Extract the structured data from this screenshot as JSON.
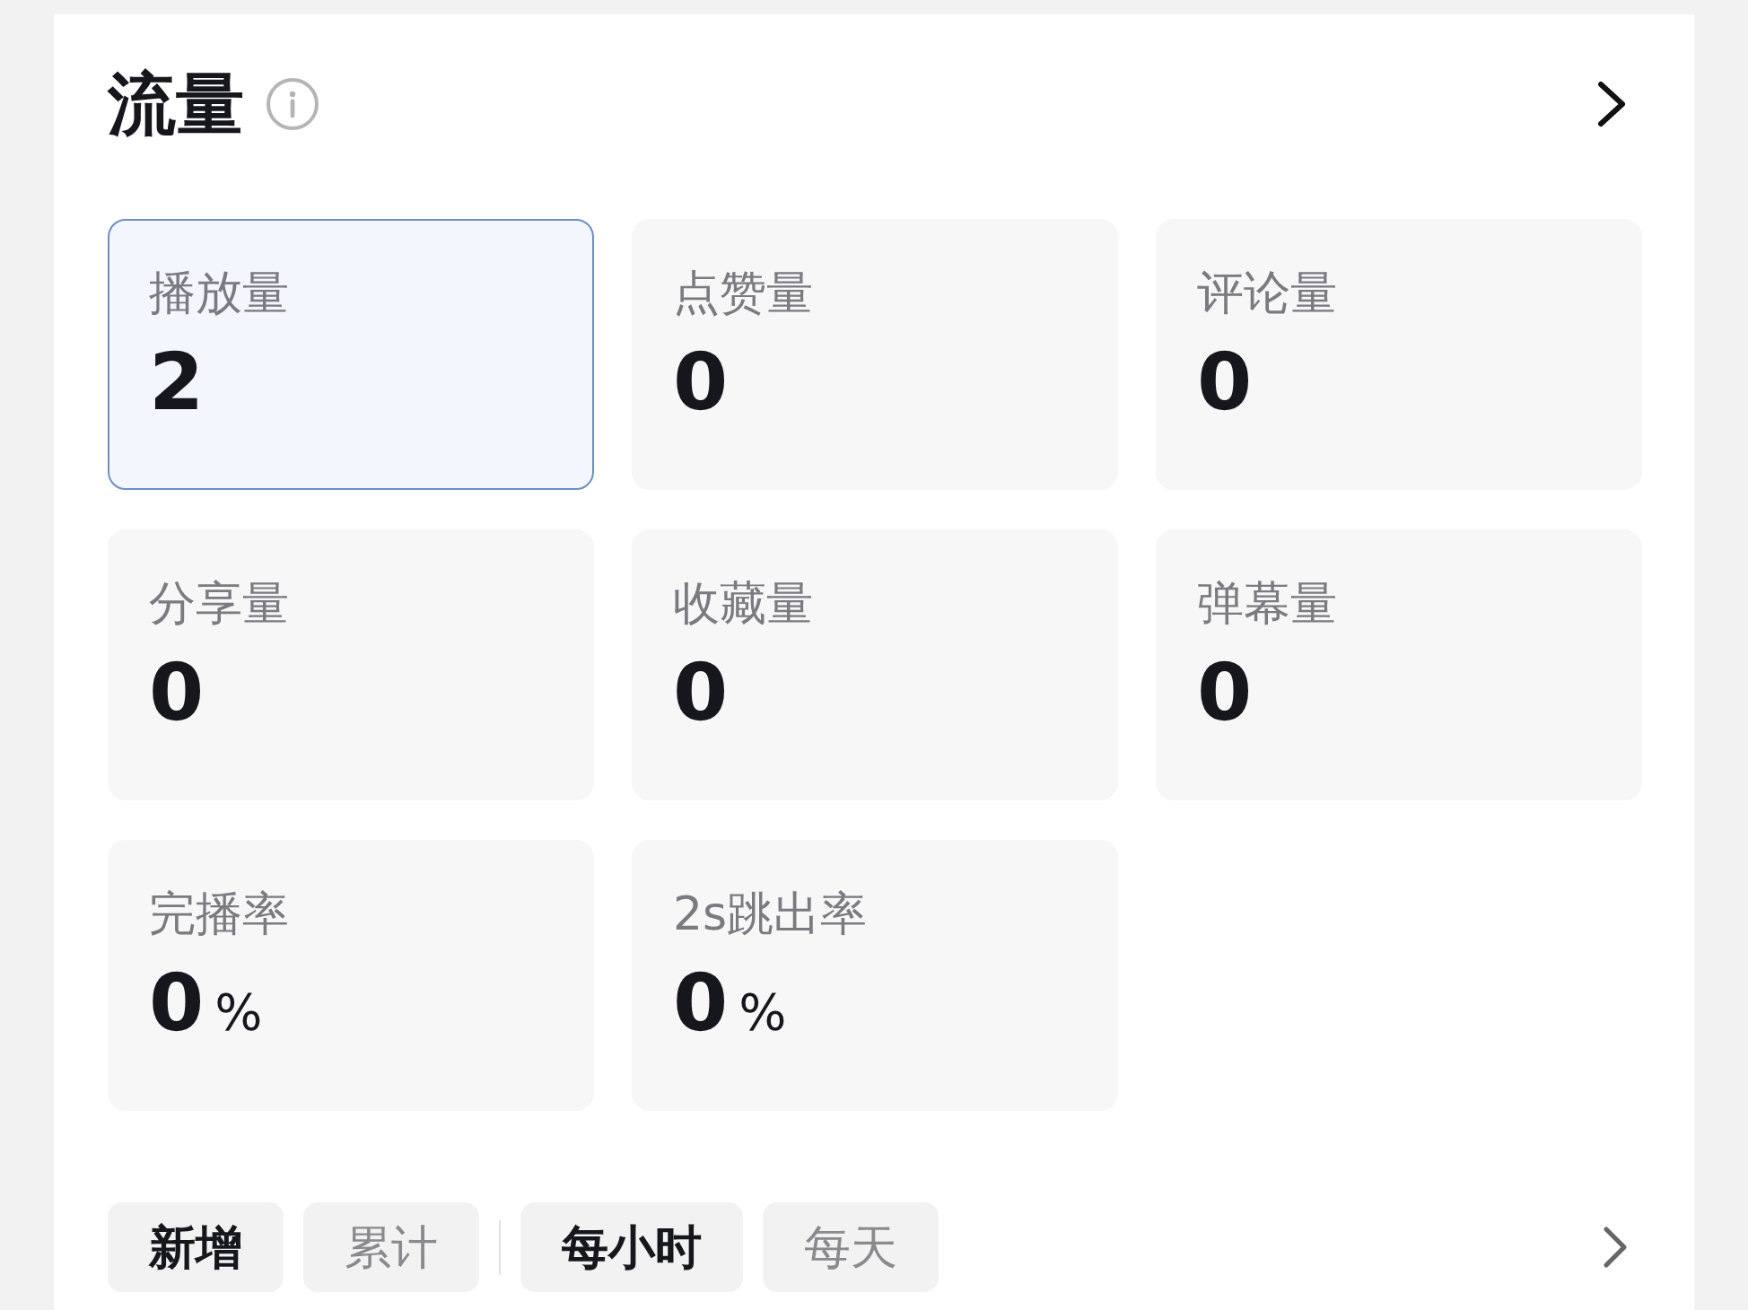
{
  "header": {
    "title": "流量"
  },
  "metrics": [
    {
      "label": "播放量",
      "value": "2",
      "selected": true
    },
    {
      "label": "点赞量",
      "value": "0",
      "selected": false
    },
    {
      "label": "评论量",
      "value": "0",
      "selected": false
    },
    {
      "label": "分享量",
      "value": "0",
      "selected": false
    },
    {
      "label": "收藏量",
      "value": "0",
      "selected": false
    },
    {
      "label": "弹幕量",
      "value": "0",
      "selected": false
    },
    {
      "label": "完播率",
      "value": "0",
      "unit": "%",
      "selected": false
    },
    {
      "label": "2s跳出率",
      "value": "0",
      "unit": "%",
      "selected": false
    }
  ],
  "filter_groups": [
    {
      "tabs": [
        {
          "label": "新增",
          "selected": true
        },
        {
          "label": "累计",
          "selected": false
        }
      ]
    },
    {
      "tabs": [
        {
          "label": "每小时",
          "selected": true
        },
        {
          "label": "每天",
          "selected": false
        }
      ]
    }
  ]
}
